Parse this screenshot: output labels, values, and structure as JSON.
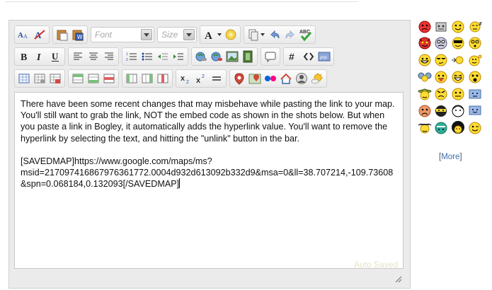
{
  "toolbar": {
    "font_placeholder": "Font",
    "size_placeholder": "Size",
    "row1_icons": [
      "font-size-icon",
      "font-style-icon",
      "paste-icon",
      "paste-word-icon",
      "font-combo",
      "size-combo",
      "text-color-icon",
      "highlight-icon",
      "paste-options-icon",
      "undo-icon",
      "redo-icon",
      "spellcheck-icon"
    ],
    "row2_icons": [
      "bold-icon",
      "italic-icon",
      "underline-icon",
      "align-left-icon",
      "align-center-icon",
      "align-right-icon",
      "ordered-list-icon",
      "unordered-list-icon",
      "outdent-icon",
      "indent-icon",
      "link-icon",
      "unlink-icon",
      "image-icon",
      "media-icon",
      "comment-icon",
      "special-character-icon",
      "html-source-icon",
      "php-icon"
    ],
    "row3_icons": [
      "table-icon",
      "table-props-icon",
      "delete-table-icon",
      "row-before-icon",
      "row-after-icon",
      "delete-row-icon",
      "col-before-icon",
      "col-after-icon",
      "delete-col-icon",
      "subscript-icon",
      "superscript-icon",
      "horizontal-rule-icon",
      "map-icon",
      "map-marker-icon",
      "flickr-icon",
      "home-icon",
      "avatar-icon",
      "weather-icon"
    ]
  },
  "editor": {
    "paragraph1": "There have been some recent changes that may misbehave while pasting the link to your map. You'll still want to grab the link, NOT the embed code as shown in the shots below. But when you paste a link in Bogley, it automatically adds the hyperlink value. You'll want to remove the hyperlink by selecting the text, and hitting the \"unlink\" button in the bar.",
    "paragraph2": "[SAVEDMAP]https://www.google.com/maps/ms?msid=217097416867976361772.0004d932d613092b332d9&msa=0&ll=38.707214,-109.73608&spn=0.068184,0.132093[/SAVEDMAP]",
    "status": "Auto Saved"
  },
  "smileys": {
    "icons": [
      "angry-smiley-icon",
      "robot-smiley-icon",
      "smile-smiley-icon",
      "sleepy-smiley-icon",
      "devil-smiley-icon",
      "confused-smiley-icon",
      "sunglasses-smiley-icon",
      "dizzy-smiley-icon",
      "grin-smiley-icon",
      "cool-smiley-icon",
      "arrow-smiley-icon",
      "waving-smiley-icon",
      "group-smiley-icon",
      "tongue-smiley-icon",
      "laughing-smiley-icon",
      "shocked-smiley-icon",
      "sombrero-smiley-icon",
      "mad-smiley-icon",
      "neutral-smiley-icon",
      "blue-box-smiley-icon",
      "sad-smiley-icon",
      "ninja-smiley-icon",
      "bald-smiley-icon",
      "computer-smiley-icon",
      "cowboy-smiley-icon",
      "crying-smiley-icon",
      "afro-smiley-icon",
      "wink-smiley-icon"
    ],
    "more_open": "[",
    "more_label": "More",
    "more_close": "]"
  }
}
